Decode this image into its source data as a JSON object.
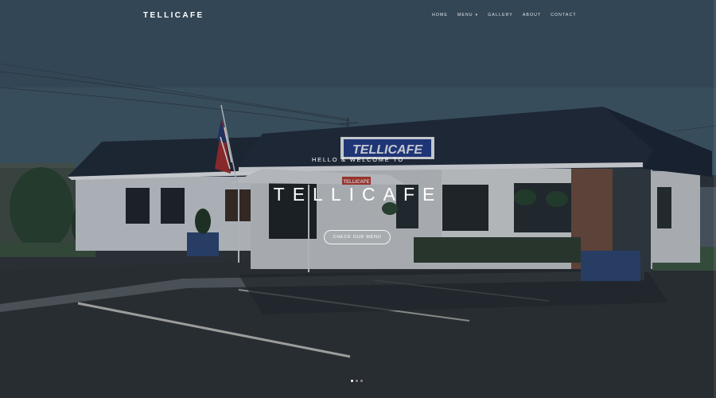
{
  "brand": {
    "name": "TELLICAFE"
  },
  "nav": {
    "items": [
      {
        "label": "HOME"
      },
      {
        "label": "MENU"
      },
      {
        "label": "GALLERY"
      },
      {
        "label": "ABOUT"
      },
      {
        "label": "CONTACT"
      }
    ]
  },
  "hero": {
    "kicker": "HELLO & WELCOME TO",
    "title": "TELLICAFE",
    "cta_label": "CHECK OUR MENU",
    "sign_text": "TELLICAFE",
    "awning_text": "TELLICAFE",
    "slides_total": 3,
    "active_slide": 1
  },
  "colors": {
    "accent": "#ffffff",
    "overlay": "#1c232a"
  }
}
